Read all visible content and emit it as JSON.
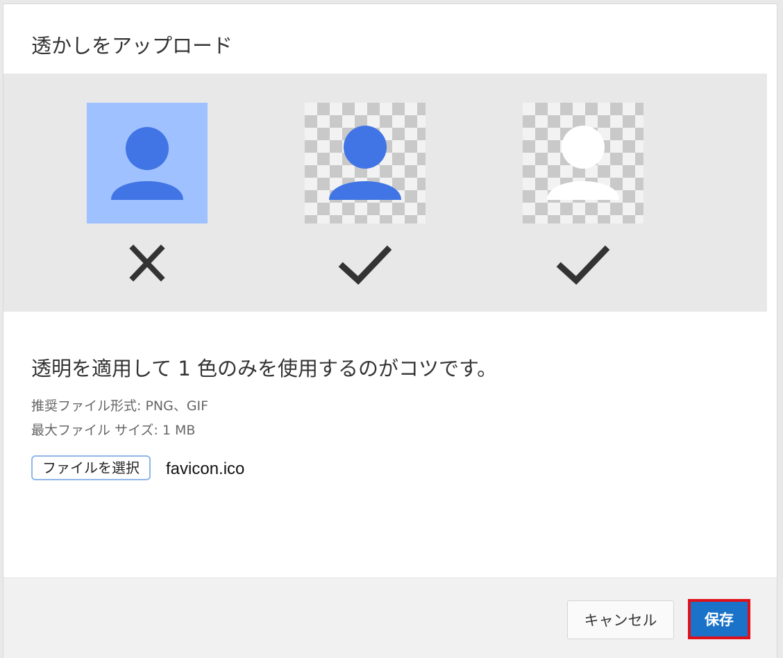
{
  "dialog": {
    "title": "透かしをアップロード",
    "examples": [
      {
        "style": "solid-background",
        "result": "x",
        "person_color": "#4174e4",
        "background_color": "#9fc1ff"
      },
      {
        "style": "transparent-blue",
        "result": "check",
        "person_color": "#4174e4"
      },
      {
        "style": "transparent-white",
        "result": "check",
        "person_color": "#ffffff"
      }
    ],
    "tip": "透明を適用して 1 色のみを使用するのがコツです。",
    "recommended_format": "推奨ファイル形式: PNG、GIF",
    "max_size": "最大ファイル サイズ: 1 MB",
    "file_button_label": "ファイルを選択",
    "file_name": "favicon.ico"
  },
  "footer": {
    "cancel_label": "キャンセル",
    "save_label": "保存"
  },
  "colors": {
    "accent": "#1a73c8",
    "highlight_border": "#e0101a",
    "mark_color": "#333333"
  }
}
